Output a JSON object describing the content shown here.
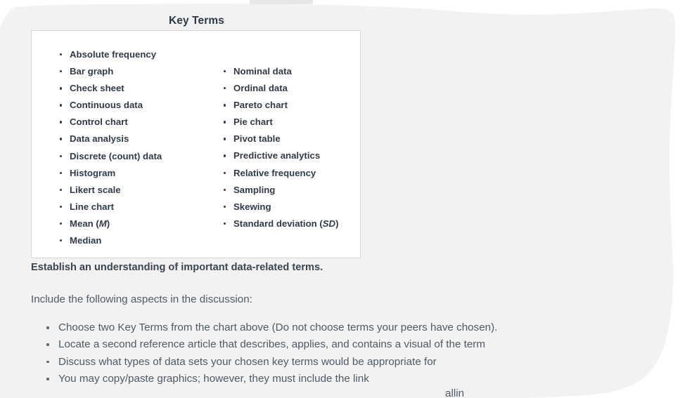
{
  "page": {
    "background_color": "#f2f2f2",
    "canvas_color": "#ffffff"
  },
  "key_terms_card": {
    "title": "Key Terms",
    "border_color": "#d8d8d8",
    "background_color": "#ffffff",
    "columns": [
      {
        "name": "left-column",
        "terms": [
          {
            "text": "Absolute frequency"
          },
          {
            "text": "Bar graph"
          },
          {
            "text": "Check sheet"
          },
          {
            "text": "Continuous data"
          },
          {
            "text": "Control chart"
          },
          {
            "text": "Data analysis"
          },
          {
            "text": "Discrete (count) data"
          },
          {
            "text": "Histogram"
          },
          {
            "text": "Likert scale"
          },
          {
            "text": "Line chart"
          },
          {
            "text": "Mean (",
            "italic": "M",
            "suffix": ")"
          },
          {
            "text": "Median"
          }
        ]
      },
      {
        "name": "right-column",
        "terms": [
          {
            "text": "Nominal data"
          },
          {
            "text": "Ordinal data"
          },
          {
            "text": "Pareto chart"
          },
          {
            "text": "Pie chart"
          },
          {
            "text": "Pivot table"
          },
          {
            "text": "Predictive analytics"
          },
          {
            "text": "Relative frequency"
          },
          {
            "text": "Sampling"
          },
          {
            "text": "Skewing"
          },
          {
            "text": "Standard deviation (",
            "italic": "SD",
            "suffix": ")"
          }
        ]
      }
    ]
  },
  "body": {
    "heading": "Establish an understanding of important data-related terms.",
    "intro": "Include the following aspects in the discussion:",
    "tasks": [
      "Choose two Key Terms from the chart above (Do not choose terms your peers have chosen).",
      "Locate a second reference article that describes, applies, and contains a visual of the term",
      "Discuss what types of data sets your chosen key terms would be appropriate for",
      "You may copy/paste graphics; however, they must include the link"
    ],
    "clipped_bottom_text": "allin"
  }
}
